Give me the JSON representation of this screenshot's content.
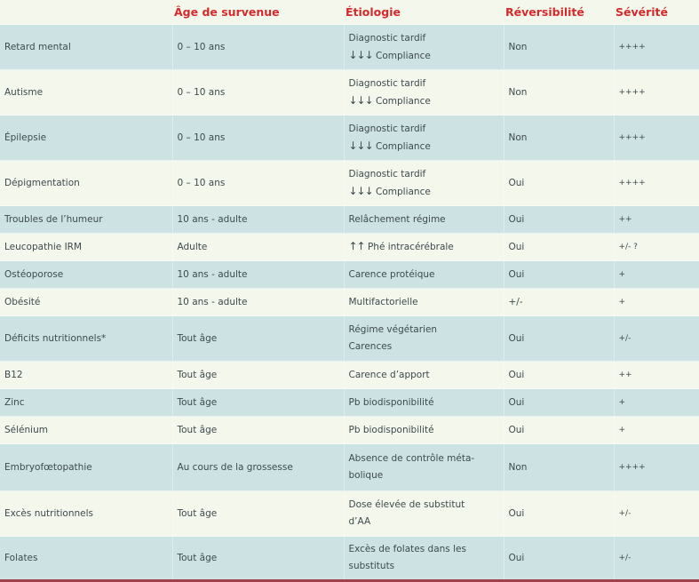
{
  "table": {
    "headers": [
      "",
      "Âge de survenue",
      "Étiologie",
      "Réversibilité",
      "Sévérité"
    ],
    "rows": [
      {
        "condition": "Retard mental",
        "age": "0 – 10 ans",
        "etiology_line1": "Diagnostic tardif",
        "etiology_arrow": "↓↓↓",
        "etiology_line2": "Compliance",
        "reversibility": "Non",
        "severity": "++++"
      },
      {
        "condition": "Autisme",
        "age": "0 – 10 ans",
        "etiology_line1": "Diagnostic tardif",
        "etiology_arrow": "↓↓↓",
        "etiology_line2": "Compliance",
        "reversibility": "Non",
        "severity": "++++"
      },
      {
        "condition": "Épilepsie",
        "age": "0 – 10 ans",
        "etiology_line1": "Diagnostic tardif",
        "etiology_arrow": "↓↓↓",
        "etiology_line2": "Compliance",
        "reversibility": "Non",
        "severity": "++++"
      },
      {
        "condition": "Dépigmentation",
        "age": "0 – 10 ans",
        "etiology_line1": "Diagnostic tardif",
        "etiology_arrow": "↓↓↓",
        "etiology_line2": "Compliance",
        "reversibility": "Oui",
        "severity": "++++"
      },
      {
        "condition": "Troubles de l’humeur",
        "age": "10 ans - adulte",
        "etiology_line1": "Relâchement régime",
        "reversibility": "Oui",
        "severity": "++"
      },
      {
        "condition": "Leucopathie IRM",
        "age": "Adulte",
        "etiology_arrow": "↑↑",
        "etiology_line1": "Phé intracérébrale",
        "reversibility": "Oui",
        "severity": "+/- ?"
      },
      {
        "condition": "Ostéoporose",
        "age": "10 ans - adulte",
        "etiology_line1": "Carence protéique",
        "reversibility": "Oui",
        "severity": "+"
      },
      {
        "condition": "Obésité",
        "age": "10 ans - adulte",
        "etiology_line1": "Multifactorielle",
        "reversibility": "+/-",
        "severity": "+"
      },
      {
        "condition": "Déficits nutritionnels*",
        "age": "Tout âge",
        "etiology_line1": "Régime végétarien",
        "etiology_line2": "Carences",
        "reversibility": "Oui",
        "severity": "+/-"
      },
      {
        "condition": "B12",
        "age": "Tout âge",
        "etiology_line1": "Carence d’apport",
        "reversibility": "Oui",
        "severity": "++"
      },
      {
        "condition": "Zinc",
        "age": "Tout âge",
        "etiology_line1": "Pb biodisponibilité",
        "reversibility": "Oui",
        "severity": "+"
      },
      {
        "condition": "Sélénium",
        "age": "Tout âge",
        "etiology_line1": "Pb biodisponibilité",
        "reversibility": "Oui",
        "severity": "+"
      },
      {
        "condition": "Embryofœtopathie",
        "age": "Au cours de la grossesse",
        "etiology_line1": "Absence de contrôle méta-",
        "etiology_line2": "bolique",
        "reversibility": "Non",
        "severity": "++++"
      },
      {
        "condition": "Excès nutritionnels",
        "age": "Tout âge",
        "etiology_line1": "Dose élevée de substitut",
        "etiology_line2": "d’AA",
        "reversibility": "Oui",
        "severity": "+/-"
      },
      {
        "condition": "Folates",
        "age": "Tout âge",
        "etiology_line1": "Excès de folates dans les",
        "etiology_line2": "substituts",
        "reversibility": "Oui",
        "severity": "+/-"
      }
    ]
  },
  "colors": {
    "header_text": "#d42a2c",
    "row_teal": "#cde3e3",
    "row_cream": "#f4f7ec",
    "bottom_border": "#a0414f",
    "body_text": "#3d4a4e"
  }
}
